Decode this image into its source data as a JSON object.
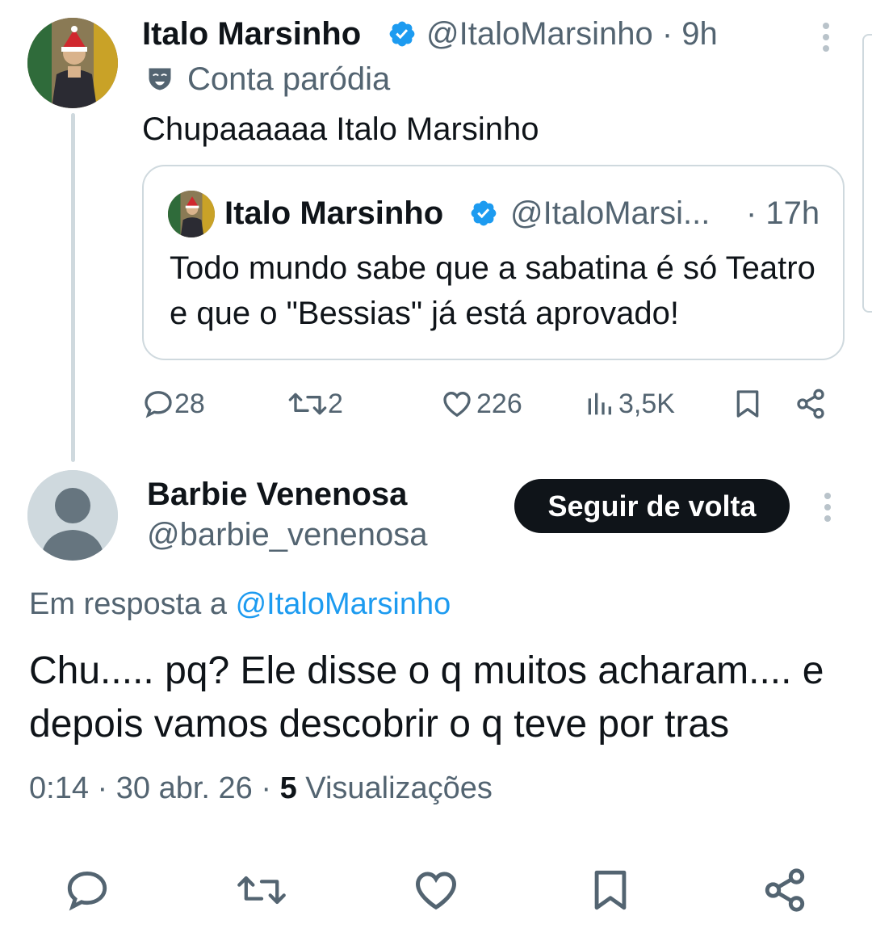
{
  "tweet": {
    "author_name": "Italo Marsinho",
    "author_handle": "@ItaloMarsinho",
    "time": "· 9h",
    "label": "Conta paródia",
    "text": "Chupaaaaaa Italo Marsinho",
    "quoted": {
      "author_name": "Italo Marsinho",
      "author_handle": "@ItaloMarsi...",
      "time": "· 17h",
      "text": "Todo mundo sabe que a sabatina é só Teatro e que o \"Bessias\" já está aprovado!"
    },
    "metrics": {
      "replies": "28",
      "reposts": "2",
      "likes": "226",
      "views": "3,5K"
    }
  },
  "reply": {
    "author_name": "Barbie Venenosa",
    "author_handle": "@barbie_venenosa",
    "follow_label": "Seguir de volta",
    "reply_prefix": "Em resposta a",
    "reply_to": "@ItaloMarsinho",
    "text": "Chu..... pq? Ele disse o q muitos acharam.... e depois vamos descobrir o q teve por tras",
    "time": "0:14",
    "date": "30 abr. 26",
    "views_count": "5",
    "views_label": "Visualizações"
  },
  "colors": {
    "accent": "#1d9bf0",
    "text": "#0f1419",
    "muted": "#536471",
    "border": "#cfd9de"
  }
}
